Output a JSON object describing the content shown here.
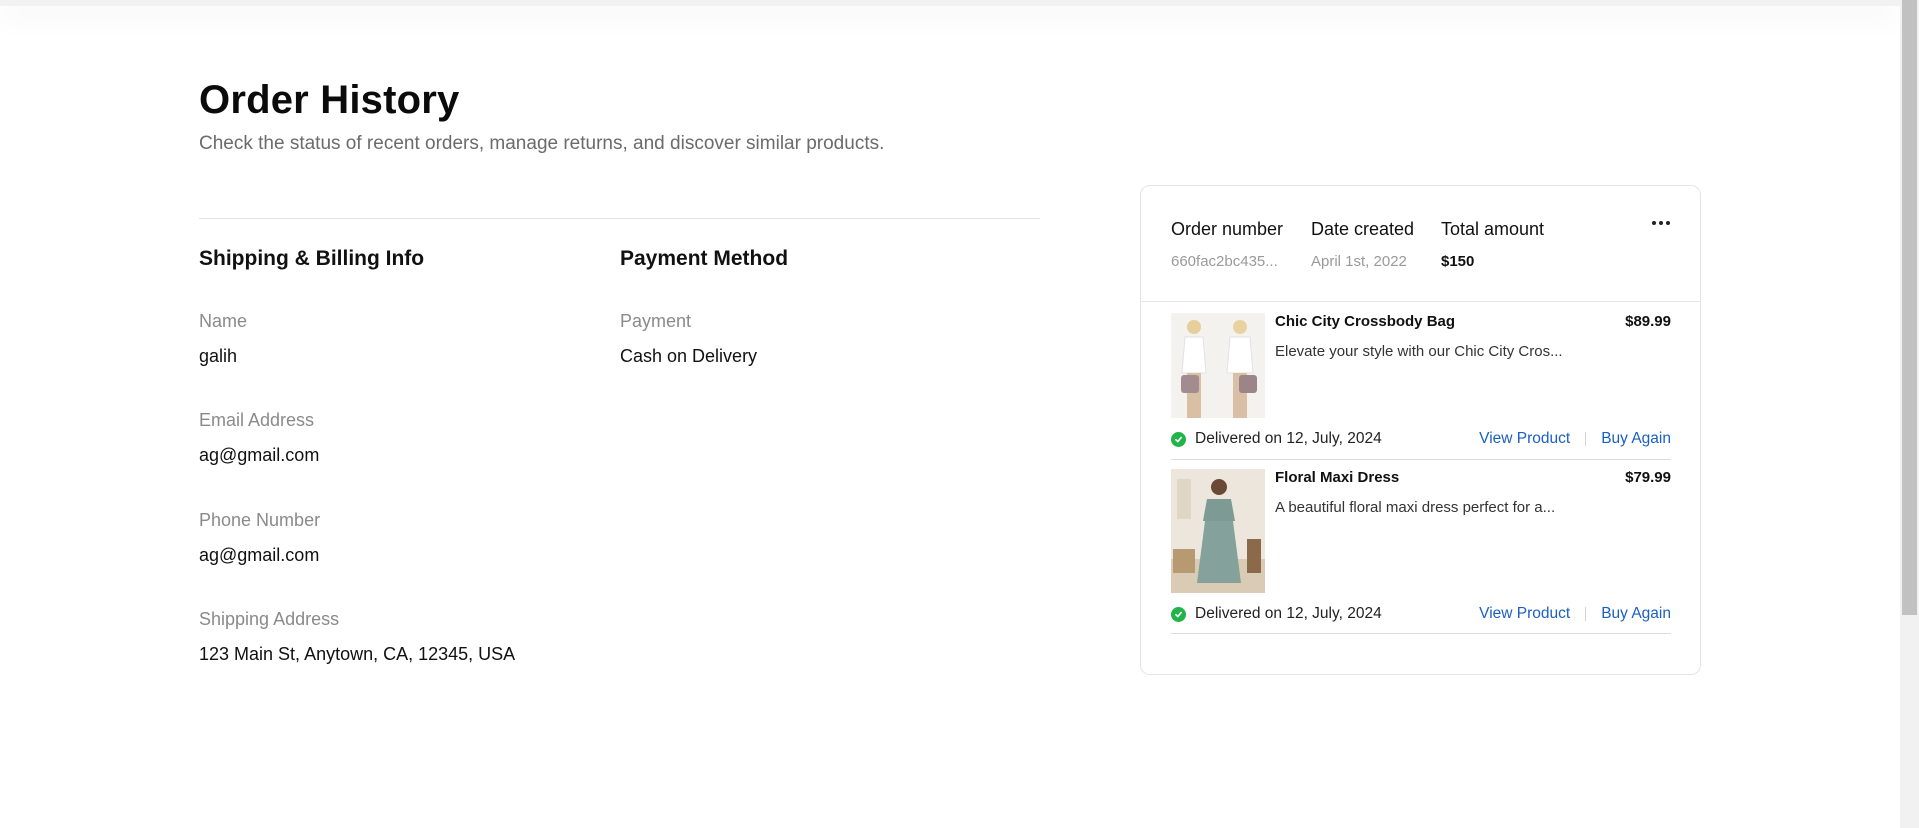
{
  "header": {
    "title": "Order History",
    "subtitle": "Check the status of recent orders, manage returns, and discover similar products."
  },
  "shipping": {
    "heading": "Shipping & Billing Info",
    "fields": [
      {
        "label": "Name",
        "value": "galih"
      },
      {
        "label": "Email Address",
        "value": "ag@gmail.com"
      },
      {
        "label": "Phone Number",
        "value": "ag@gmail.com"
      },
      {
        "label": "Shipping Address",
        "value": "123 Main St, Anytown, CA, 12345, USA"
      }
    ]
  },
  "payment": {
    "heading": "Payment Method",
    "label": "Payment",
    "value": "Cash on Delivery"
  },
  "order": {
    "number_label": "Order number",
    "number_value": "660fac2bc435...",
    "date_label": "Date created",
    "date_value": "April 1st, 2022",
    "total_label": "Total amount",
    "total_value": "$150",
    "more_icon": "more-horizontal-icon",
    "items": [
      {
        "name": "Chic City Crossbody Bag",
        "price": "$89.99",
        "description": "Elevate your style with our Chic City Cros...",
        "status": "Delivered on 12, July, 2024",
        "view_label": "View Product",
        "buy_label": "Buy Again"
      },
      {
        "name": "Floral Maxi Dress",
        "price": "$79.99",
        "description": "A beautiful floral maxi dress perfect for a...",
        "status": "Delivered on 12, July, 2024",
        "view_label": "View Product",
        "buy_label": "Buy Again"
      }
    ]
  },
  "colors": {
    "link": "#1a5fc2",
    "status_green": "#22b34a",
    "muted": "#8a8a8a"
  }
}
